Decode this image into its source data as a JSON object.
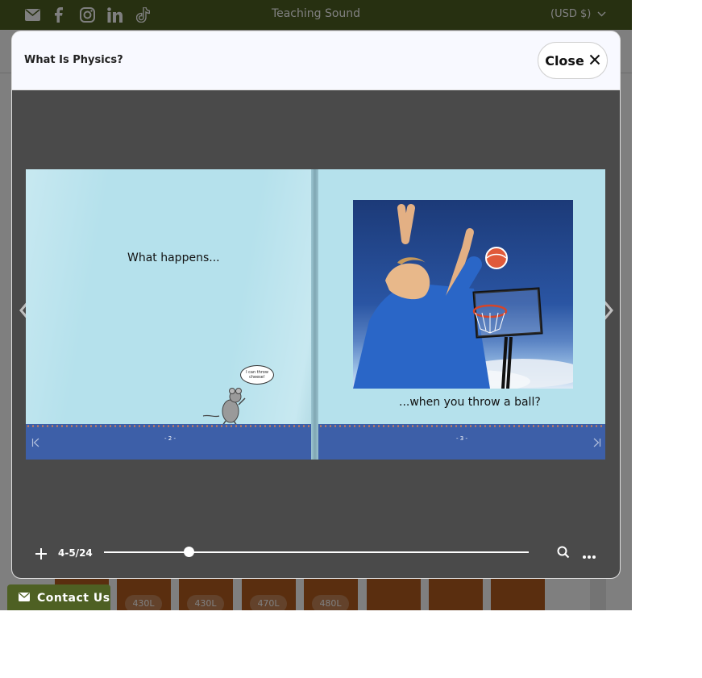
{
  "topbar": {
    "title": "Teaching Sound",
    "currency": "(USD $)",
    "social_icons": [
      "email-icon",
      "facebook-icon",
      "instagram-icon",
      "linkedin-icon",
      "tiktok-icon"
    ],
    "background": "#4e6023"
  },
  "tiles": {
    "labels": [
      "430L",
      "430L",
      "470L",
      "480L"
    ]
  },
  "contact": {
    "label": "Contact Us",
    "icon": "envelope-icon"
  },
  "modal": {
    "title": "What Is Physics?",
    "close_label": "Close",
    "close_icon": "close-icon"
  },
  "book": {
    "left_page": {
      "text": "What happens...",
      "speech_bubble": "I can throw cheese!",
      "page_number": "- 2 -"
    },
    "right_page": {
      "caption": "...when you throw a ball?",
      "page_number": "- 3 -"
    },
    "background": "#b5e1ec",
    "band_color": "#3d5fa8"
  },
  "controls": {
    "zoom_icon": "plus-icon",
    "page_indicator": "4-5/24",
    "progress": 0.2,
    "search_icon": "search-icon",
    "more_icon": "more-icon",
    "prev_icon": "chevron-left-icon",
    "next_icon": "chevron-right-icon"
  }
}
